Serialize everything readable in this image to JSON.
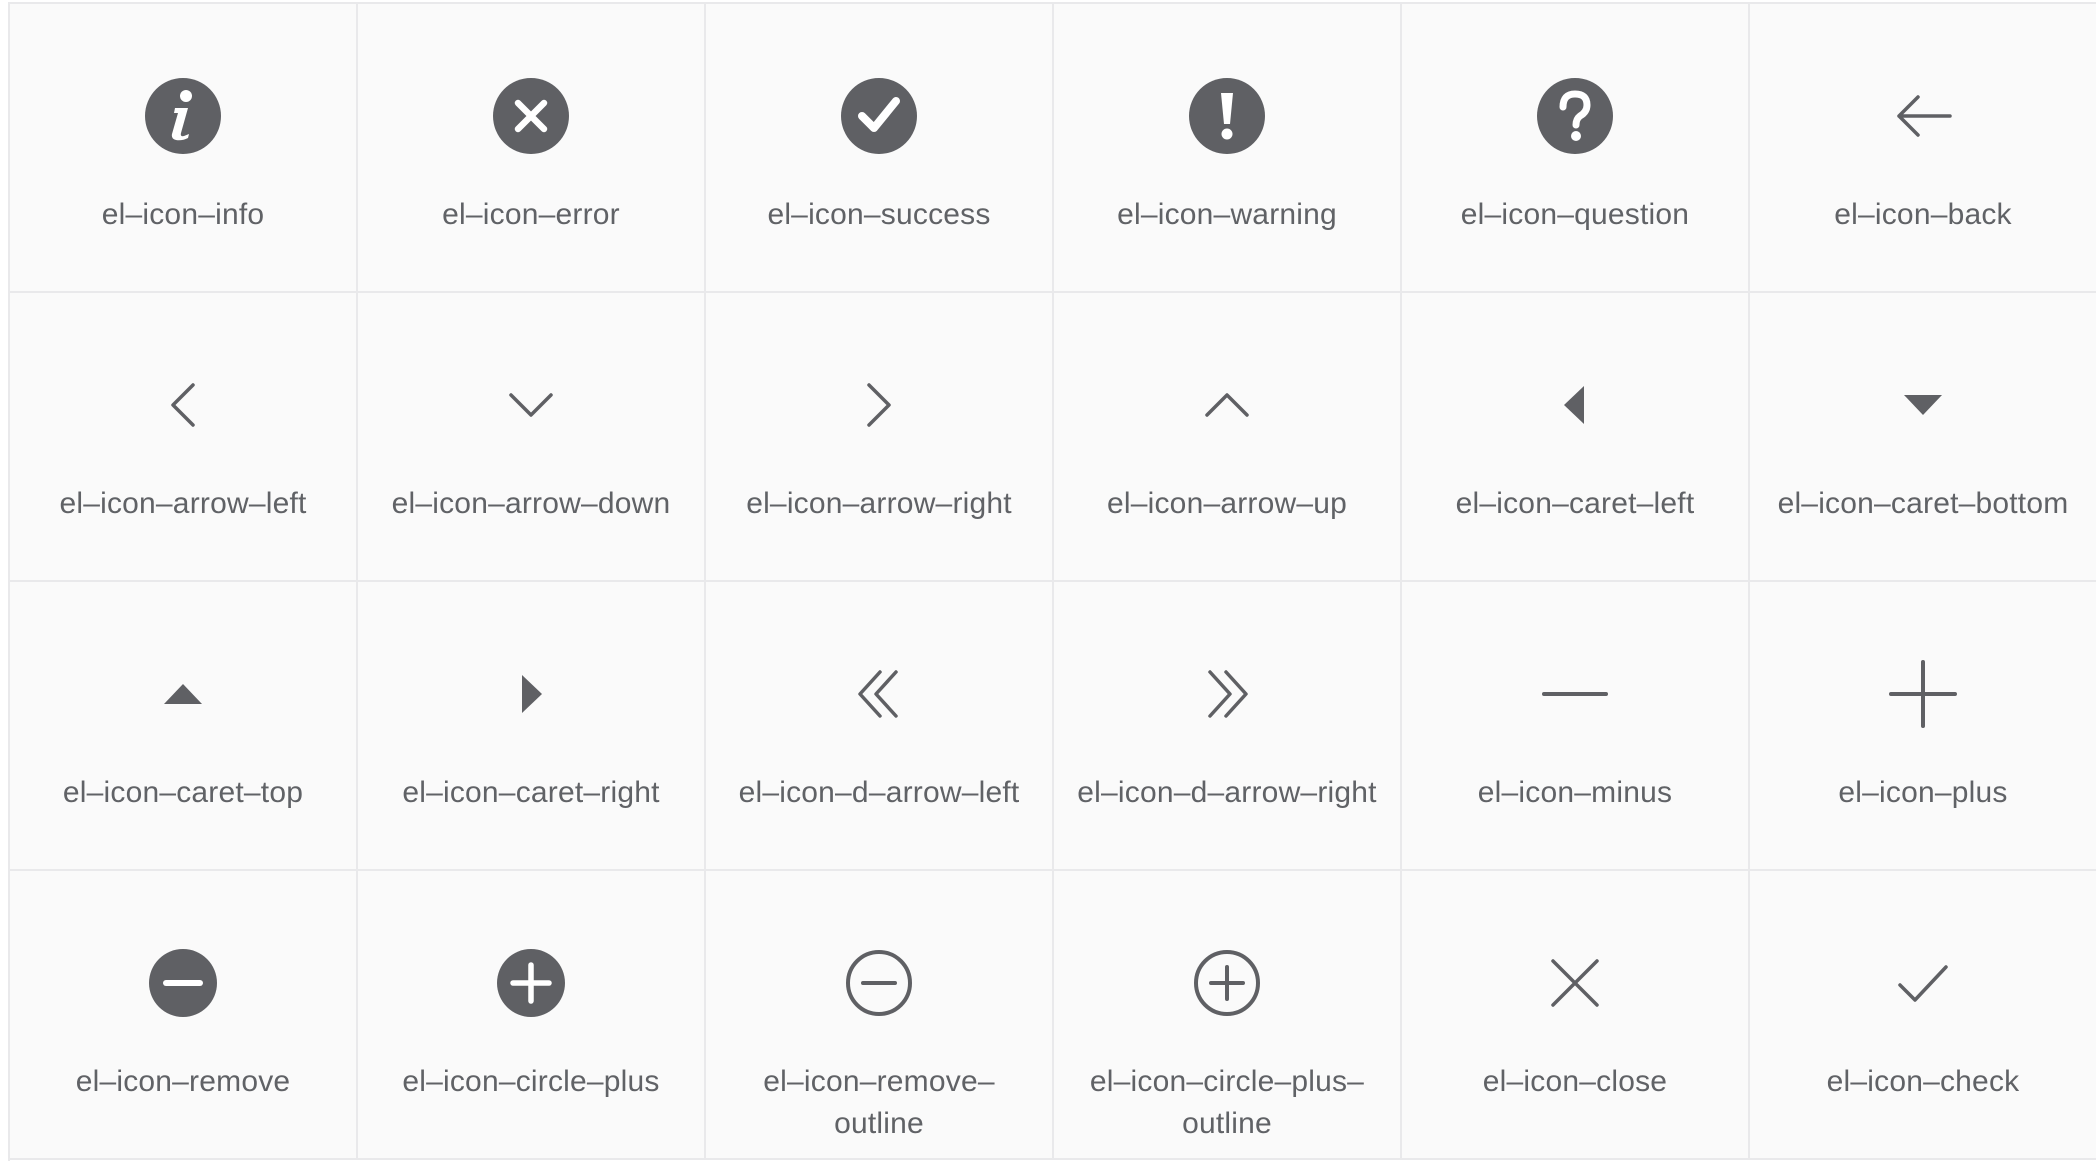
{
  "colors": {
    "icon": "#5f6064",
    "label": "#606266",
    "grid_line": "#e9e9eb",
    "cell_background": "#fafafa"
  },
  "icons": [
    {
      "name": "info-icon",
      "shape": "info",
      "label": "el–icon–info"
    },
    {
      "name": "error-icon",
      "shape": "error",
      "label": "el–icon–error"
    },
    {
      "name": "success-icon",
      "shape": "success",
      "label": "el–icon–success"
    },
    {
      "name": "warning-icon",
      "shape": "warning",
      "label": "el–icon–warning"
    },
    {
      "name": "question-icon",
      "shape": "question",
      "label": "el–icon–question"
    },
    {
      "name": "back-icon",
      "shape": "back",
      "label": "el–icon–back"
    },
    {
      "name": "arrow-left-icon",
      "shape": "arrow-left",
      "label": "el–icon–arrow–left"
    },
    {
      "name": "arrow-down-icon",
      "shape": "arrow-down",
      "label": "el–icon–arrow–down"
    },
    {
      "name": "arrow-right-icon",
      "shape": "arrow-right",
      "label": "el–icon–arrow–right"
    },
    {
      "name": "arrow-up-icon",
      "shape": "arrow-up",
      "label": "el–icon–arrow–up"
    },
    {
      "name": "caret-left-icon",
      "shape": "caret-left",
      "label": "el–icon–caret–left"
    },
    {
      "name": "caret-bottom-icon",
      "shape": "caret-bottom",
      "label": "el–icon–caret–bottom"
    },
    {
      "name": "caret-top-icon",
      "shape": "caret-top",
      "label": "el–icon–caret–top"
    },
    {
      "name": "caret-right-icon",
      "shape": "caret-right",
      "label": "el–icon–caret–right"
    },
    {
      "name": "d-arrow-left-icon",
      "shape": "d-arrow-left",
      "label": "el–icon–d–arrow–left"
    },
    {
      "name": "d-arrow-right-icon",
      "shape": "d-arrow-right",
      "label": "el–icon–d–arrow–right"
    },
    {
      "name": "minus-icon",
      "shape": "minus",
      "label": "el–icon–minus"
    },
    {
      "name": "plus-icon",
      "shape": "plus",
      "label": "el–icon–plus"
    },
    {
      "name": "remove-icon",
      "shape": "remove",
      "label": "el–icon–remove"
    },
    {
      "name": "circle-plus-icon",
      "shape": "circle-plus",
      "label": "el–icon–circle–plus"
    },
    {
      "name": "remove-outline-icon",
      "shape": "remove-outline",
      "label": [
        "el–icon–remove–",
        "outline"
      ]
    },
    {
      "name": "circle-plus-outline-icon",
      "shape": "circle-plus-outline",
      "label": [
        "el–icon–circle–plus–",
        "outline"
      ]
    },
    {
      "name": "close-icon",
      "shape": "close",
      "label": "el–icon–close"
    },
    {
      "name": "check-icon",
      "shape": "check",
      "label": "el–icon–check"
    }
  ]
}
